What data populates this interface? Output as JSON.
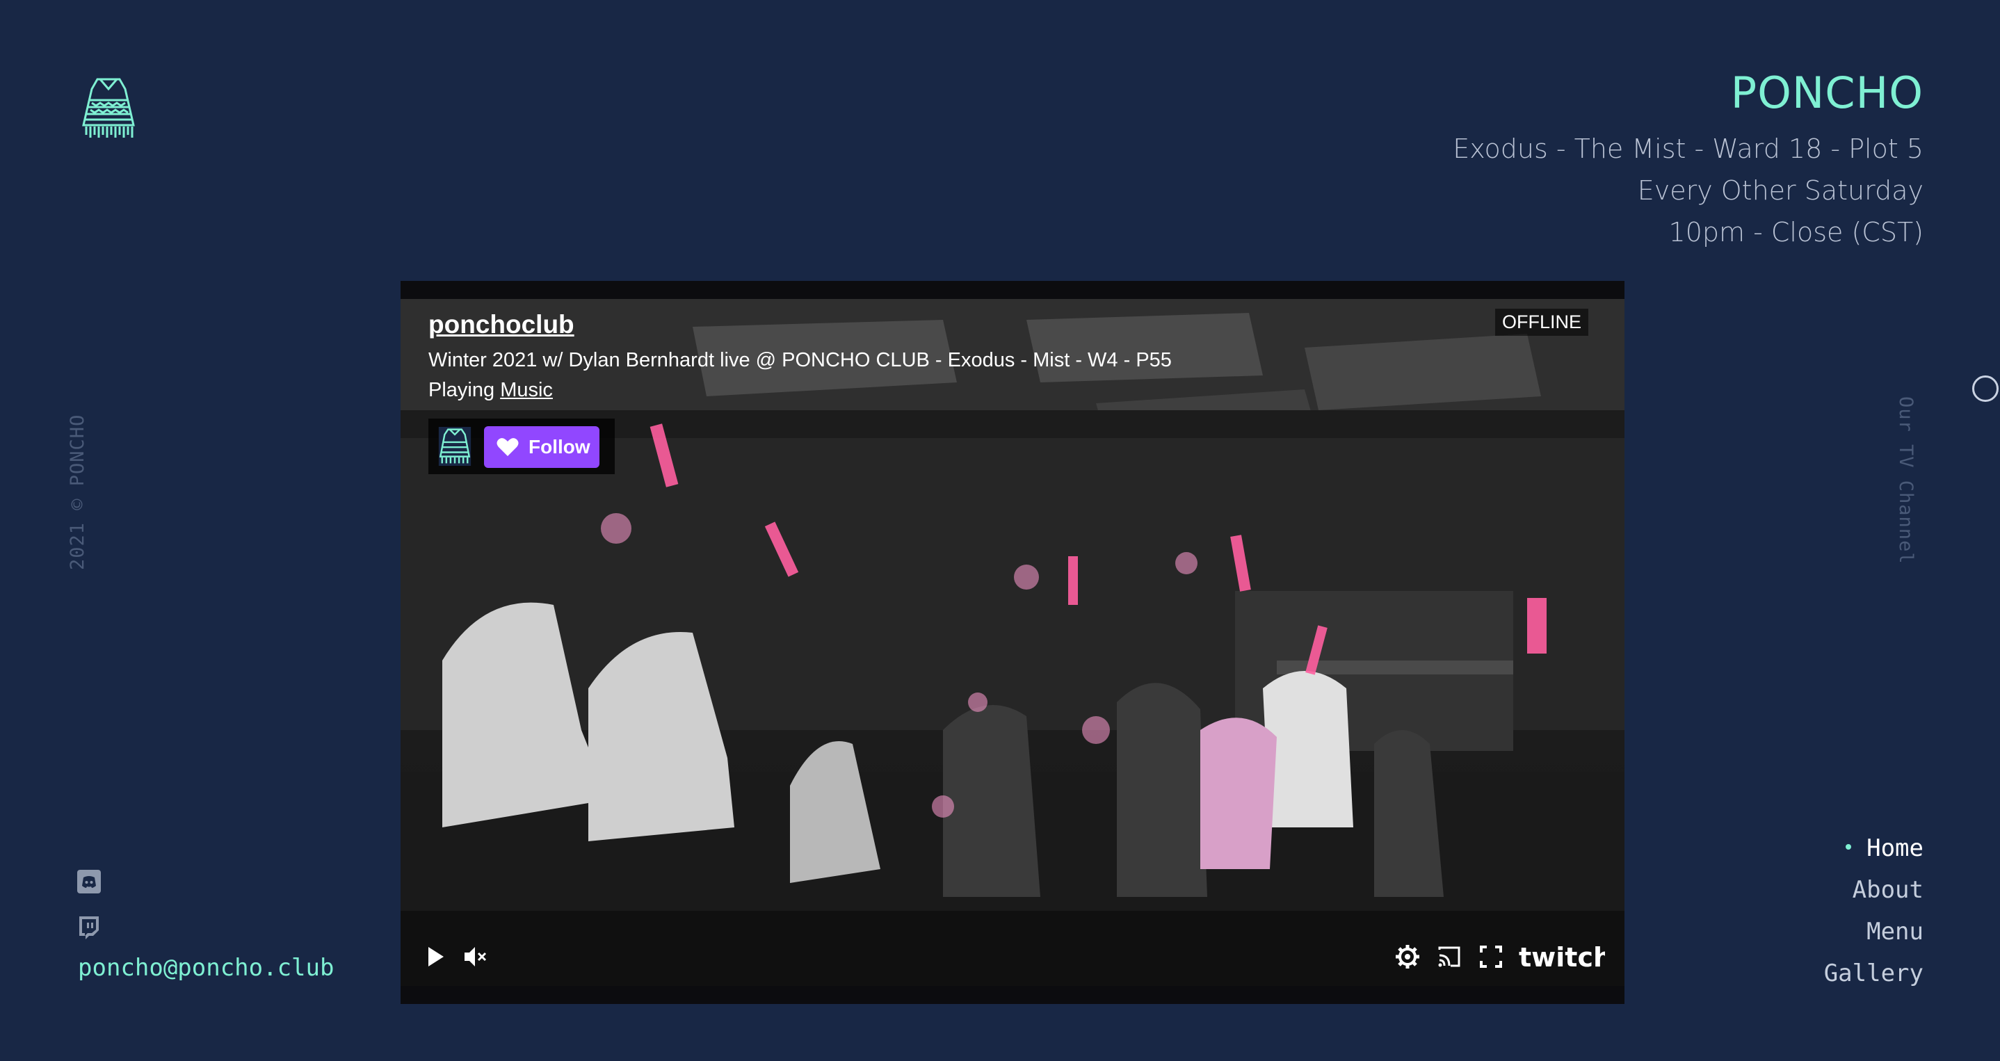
{
  "brand": {
    "name": "PONCHO",
    "location": "Exodus - The Mist - Ward 18 - Plot 5",
    "schedule": "Every Other Saturday",
    "hours": "10pm - Close (CST)"
  },
  "sidebar": {
    "copyright": "2021 © PONCHO",
    "tv_label": "Our TV Channel",
    "email": "poncho@poncho.club",
    "social": [
      "discord-icon",
      "twitch-icon"
    ]
  },
  "nav": {
    "items": [
      {
        "label": "Home",
        "active": true
      },
      {
        "label": "About",
        "active": false
      },
      {
        "label": "Menu",
        "active": false
      },
      {
        "label": "Gallery",
        "active": false
      }
    ]
  },
  "player": {
    "channel": "ponchoclub",
    "title": "Winter 2021 w/ Dylan Bernhardt live @ PONCHO CLUB - Exodus - Mist - W4 - P55",
    "playing_prefix": "Playing",
    "game": "Music",
    "status": "OFFLINE",
    "follow_label": "Follow",
    "controls": [
      "play-icon",
      "mute-icon",
      "settings-icon",
      "cast-icon",
      "fullscreen-icon"
    ],
    "brand": "twitch"
  },
  "colors": {
    "background": "#182745",
    "accent": "#7ff0d3",
    "follow": "#9147ff",
    "muted_text": "#4a5a78"
  }
}
